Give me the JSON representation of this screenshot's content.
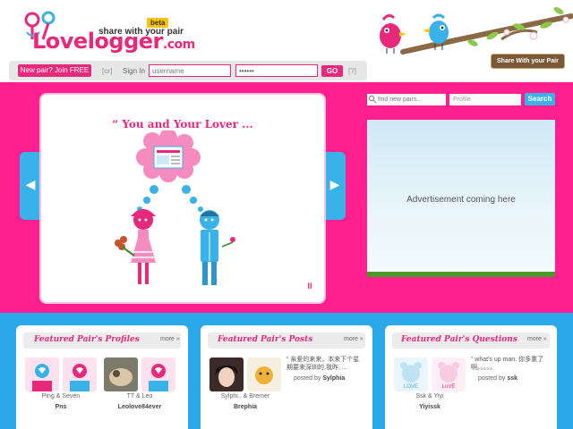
{
  "header": {
    "logo_text": "Lovelogger",
    "logo_tld": ".com",
    "tagline": "share with your pair",
    "beta_badge": "beta",
    "share_badge": "Share With your Pair"
  },
  "login": {
    "join_label": "New pair? Join FREE",
    "or_label": "[or]",
    "signin_label": "Sign In",
    "username_value": "username",
    "password_value": "••••••",
    "go_label": "GO",
    "help_label": "[?]"
  },
  "slider": {
    "title": "“ You and Your Lover ...",
    "pause_label": "II",
    "prev_label": "◀",
    "next_label": "▶"
  },
  "search": {
    "placeholder": "find new pairs...",
    "select_value": "Profile",
    "button_label": "Search"
  },
  "ad": {
    "text": "Advertisement coming here"
  },
  "panels": {
    "profiles": {
      "title": "Featured Pair's Profiles",
      "more": "more »",
      "items": [
        {
          "caption": "Ping & Seven",
          "user": "Pns"
        },
        {
          "caption": "TT & Leo",
          "user": "Leolove84ever"
        }
      ]
    },
    "posts": {
      "title": "Featured Pair's Posts",
      "more": "more »",
      "caption": "Sylphi.. & Bremer",
      "user": "Brephia",
      "quote": "“ 亲爱的来来，本来下个星期要来深圳的,我昨, ...",
      "posted_prefix": "posted by",
      "posted_user": "Sylphia"
    },
    "questions": {
      "title": "Featured Pair's Questions",
      "more": "more »",
      "caption": "Ssk & Yiyi",
      "user": "Yiyissk",
      "quote": "“ what's up man. 你多重了 啊。。。。。",
      "posted_prefix": "posted by",
      "posted_user": "ssk"
    }
  },
  "colors": {
    "brand_pink": "#e8297b",
    "band_pink": "#ff1f8f",
    "band_blue": "#2aa8ea",
    "accent_blue": "#38b2e8"
  }
}
